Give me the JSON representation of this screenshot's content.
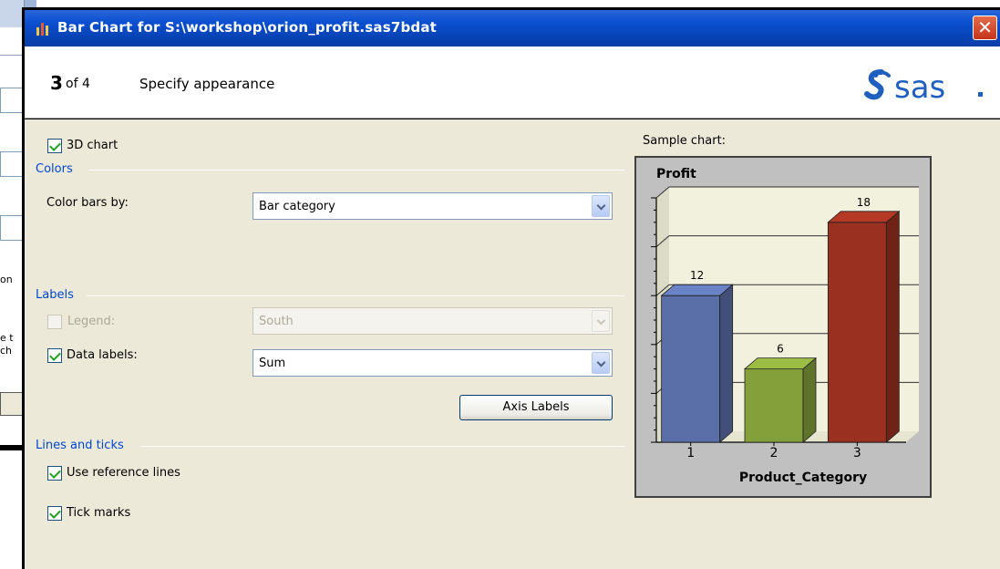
{
  "window": {
    "title": "Bar Chart for S:\\workshop\\orion_profit.sas7bdat",
    "close_symbol": "✕"
  },
  "header": {
    "step_number": "3",
    "step_of": "of 4",
    "step_title": "Specify appearance",
    "logo_text": "sas"
  },
  "options": {
    "chart_3d": {
      "label": "3D chart",
      "checked": true
    }
  },
  "colors": {
    "group_label": "Colors",
    "color_bars_by_label": "Color bars by:",
    "color_bars_by_value": "Bar category"
  },
  "labels": {
    "group_label": "Labels",
    "legend_label": "Legend:",
    "legend_checked": false,
    "legend_value": "South",
    "data_labels_label": "Data labels:",
    "data_labels_checked": true,
    "data_labels_value": "Sum",
    "axis_labels_button": "Axis Labels"
  },
  "lines_ticks": {
    "group_label": "Lines and ticks",
    "reference_lines_label": "Use reference lines",
    "reference_lines_checked": true,
    "tick_marks_label": "Tick marks",
    "tick_marks_checked": true
  },
  "sample": {
    "caption": "Sample chart:"
  },
  "background_app": {
    "text_1": "on",
    "text_2": "e t",
    "text_3": "ch"
  },
  "chart_data": {
    "type": "bar",
    "title": "Profit",
    "xlabel": "Product_Category",
    "ylabel": "",
    "categories": [
      "1",
      "2",
      "3"
    ],
    "values": [
      12,
      6,
      18
    ],
    "data_labels": [
      "12",
      "6",
      "18"
    ],
    "colors": [
      "#5a6ea8",
      "#84a03a",
      "#9a3020"
    ],
    "ylim": [
      0,
      20
    ],
    "grid": true,
    "three_d": true
  }
}
